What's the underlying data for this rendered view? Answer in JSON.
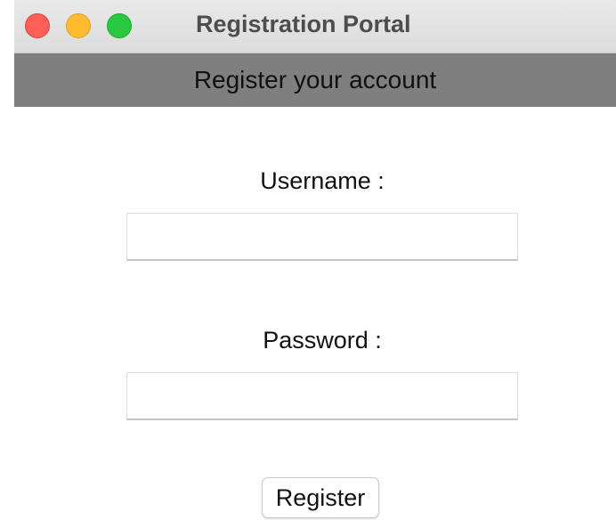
{
  "window": {
    "title": "Registration Portal",
    "controls": {
      "close": "close-icon",
      "minimize": "minimize-icon",
      "maximize": "maximize-icon"
    },
    "colors": {
      "close": "#fe5f57",
      "minimize": "#febc2e",
      "maximize": "#28c840"
    }
  },
  "header": {
    "text": "Register your account",
    "background": "#7f7f7f"
  },
  "form": {
    "username": {
      "label": "Username :",
      "value": ""
    },
    "password": {
      "label": "Password :",
      "value": ""
    },
    "submit_label": "Register"
  }
}
